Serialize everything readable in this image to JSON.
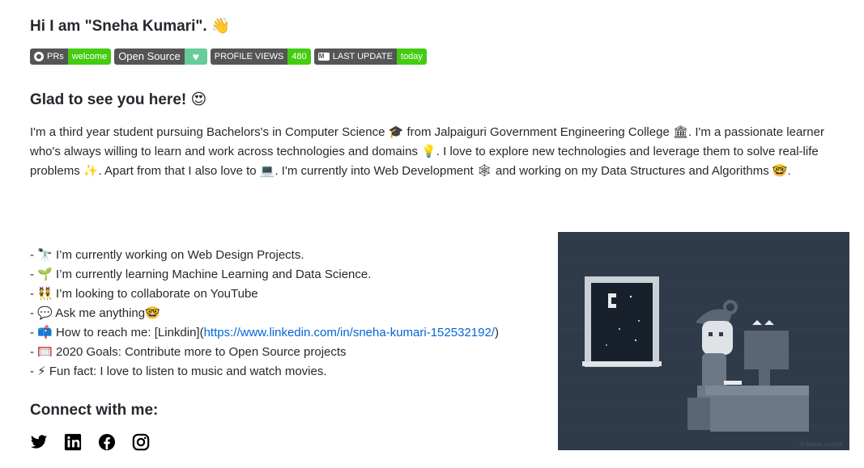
{
  "header": {
    "title": "Hi I am \"Sneha Kumari\".",
    "title_emoji": "👋"
  },
  "badges": [
    {
      "left": "PRs",
      "right": "welcome",
      "icon": "github-icon"
    },
    {
      "left": "Open Source",
      "right": "♥",
      "icon": "heart-icon"
    },
    {
      "left": "PROFILE VIEWS",
      "right": "480"
    },
    {
      "left": "LAST UPDATE",
      "right": "today",
      "icon": "markdown-icon"
    }
  ],
  "glad": {
    "text": "Glad to see you here!",
    "emoji": "😍"
  },
  "intro": {
    "text": "I'm a third year student pursuing Bachelors's in Computer Science 🎓 from Jalpaiguri Government Engineering College 🏛. I'm a passionate learner who's always willing to learn and work across technologies and domains 💡. I love to explore new technologies and leverage them to solve real-life problems ✨. Apart from that I also love to 💻. I'm currently into Web Development 🕸 and working on my Data Structures and Algorithms 🤓."
  },
  "facts": [
    {
      "prefix": "- 🔭 ",
      "text": "I’m currently working on Web Design Projects."
    },
    {
      "prefix": "- 🌱 ",
      "text": "I’m currently learning Machine Learning and Data Science."
    },
    {
      "prefix": "- 👯 ",
      "text": "I’m looking to collaborate on YouTube"
    },
    {
      "prefix": "- 💬 ",
      "text": "Ask me anything🤓"
    },
    {
      "prefix": "- 📫 ",
      "text": "How to reach me: [Linkdin](",
      "link": "https://www.linkedin.com/in/sneha-kumari-152532192/",
      "suffix": ")"
    },
    {
      "prefix": "- 🥅 ",
      "text": "2020 Goals: Contribute more to Open Source projects"
    },
    {
      "prefix": "- ⚡ ",
      "text": "Fun fact: I love to listen to music and watch movies."
    }
  ],
  "connect": {
    "title": "Connect with me:"
  },
  "socials": [
    {
      "name": "twitter-icon"
    },
    {
      "name": "linkedin-icon"
    },
    {
      "name": "facebook-icon"
    },
    {
      "name": "instagram-icon"
    }
  ],
  "illustration": {
    "credit": "dribbble.com/d"
  }
}
